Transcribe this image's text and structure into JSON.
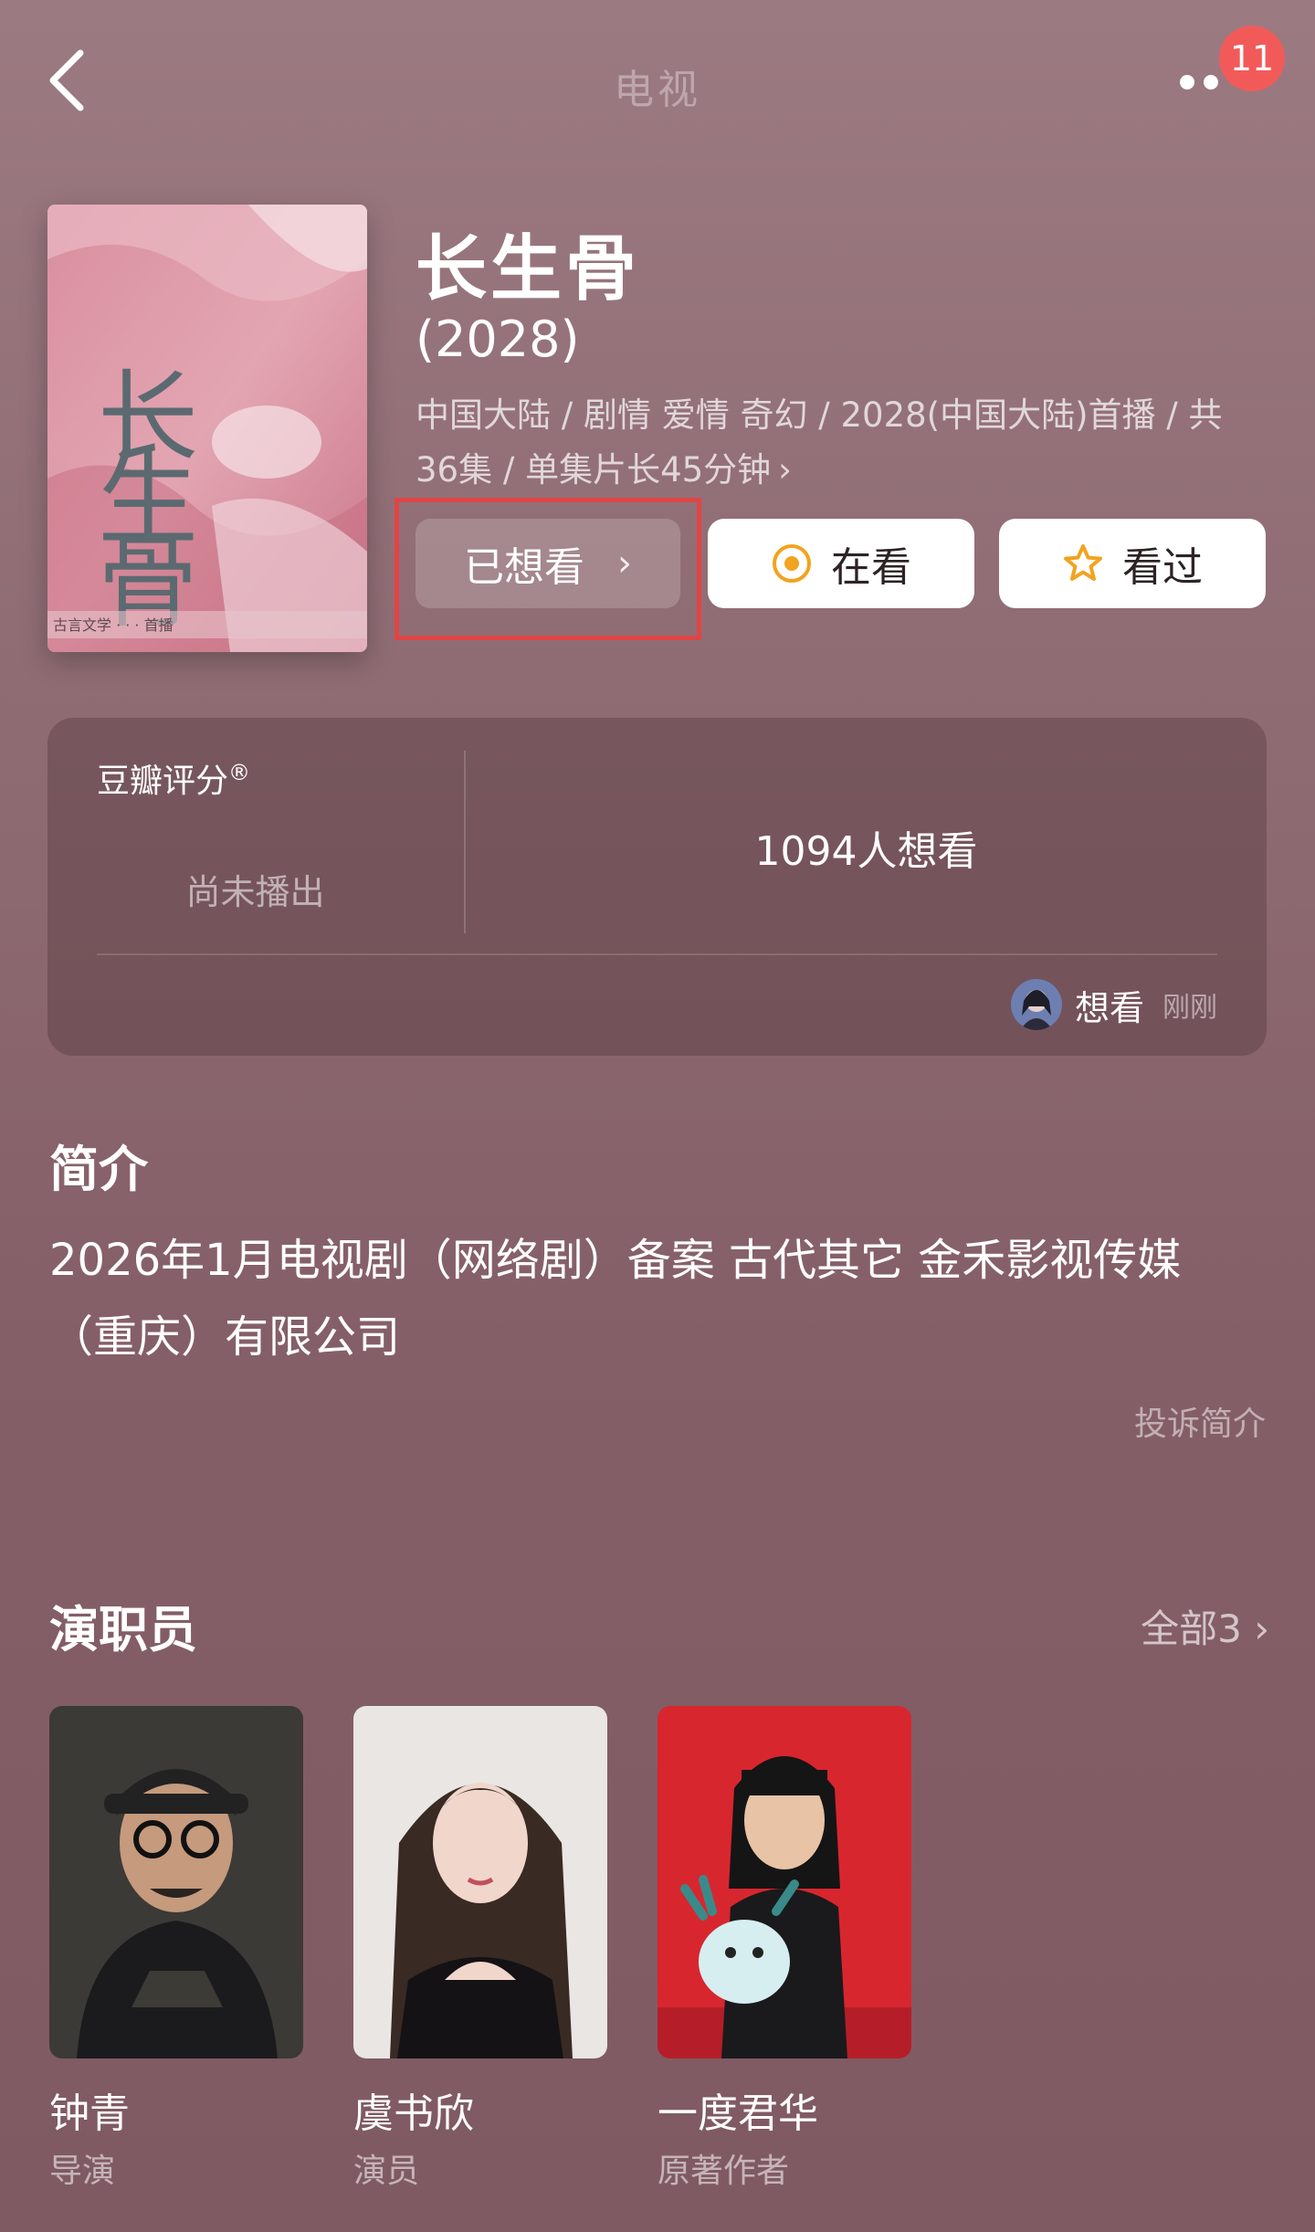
{
  "nav": {
    "title": "电视",
    "badge_count": "11",
    "back_icon": "chevron-left-icon",
    "more_icon": "more-dots-icon"
  },
  "poster": {
    "title_text": "长生骨",
    "bottom_strip": "古言文学 ·  ·  · 首播"
  },
  "show": {
    "title": "长生骨",
    "year": "(2028)",
    "meta": "中国大陆 / 剧情 爱情 奇幻 / 2028(中国大陆)首播 / 共36集 / 单集片长45分钟",
    "meta_chevron": "›"
  },
  "actions": {
    "wanted_label": "已想看",
    "wanted_chevron": "›",
    "watching_label": "在看",
    "watched_label": "看过",
    "watching_icon": "target-circle-icon",
    "watched_icon": "star-icon",
    "accent_color": "#f2a31f"
  },
  "rating": {
    "label": "豆瓣评分",
    "registered_mark": "®",
    "status": "尚未播出",
    "wish_count_text": "1094人想看",
    "activity_label": "想看",
    "activity_time": "刚刚"
  },
  "synopsis": {
    "title": "简介",
    "text": "2026年1月电视剧（网络剧）备案 古代其它 金禾影视传媒（重庆）有限公司",
    "report_label": "投诉简介"
  },
  "cast": {
    "title": "演职员",
    "all_label": "全部3",
    "all_chevron": "›",
    "members": [
      {
        "name": "钟青",
        "role": "导演"
      },
      {
        "name": "虞书欣",
        "role": "演员"
      },
      {
        "name": "一度君华",
        "role": "原著作者"
      }
    ]
  }
}
